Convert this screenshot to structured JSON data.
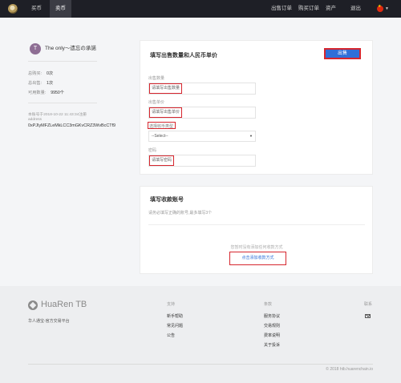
{
  "nav": {
    "buy": "买币",
    "sell": "卖币",
    "sell_orders": "出售订单",
    "buy_orders": "购买订单",
    "assets": "资产",
    "logout": "退出"
  },
  "user": {
    "avatar_letter": "T",
    "name": "The only～遗忘の承諾",
    "stats": [
      {
        "label": "总购买:",
        "value": "0次"
      },
      {
        "label": "总出售:",
        "value": "1次"
      },
      {
        "label": "可用数量:",
        "value": "9950个"
      }
    ],
    "register_note": "本账号于2018-10-22 11:43:34注册",
    "address_label": "address",
    "address": "0xPJIyMFZLeMkLCC3mGKvCRZ3WvBcCTf9"
  },
  "sell_form": {
    "title": "填写出售数量和人民币单价",
    "submit": "出售",
    "fields": [
      {
        "label": "出售数量",
        "placeholder": "请填写出售数量"
      },
      {
        "label": "出售单价",
        "placeholder": "请填写出售单价"
      },
      {
        "label": "选择收币类型",
        "placeholder": "--Select--"
      },
      {
        "label": "密码",
        "placeholder": "请填写密码"
      }
    ]
  },
  "payment": {
    "title": "填写收款账号",
    "hint": "请务必填写正确的账号,最多填写3个",
    "empty_note": "您暂时没有添加任何收款方式",
    "add_link": "点击添加收款方式"
  },
  "footer": {
    "brand": "HuaRen TB",
    "tagline": "华人通宝-官方交易平台",
    "support_heading": "支持",
    "support_links": [
      "新手帮助",
      "常见问题",
      "公告"
    ],
    "service_heading": "条款",
    "service_links": [
      "服务协议",
      "交易规则",
      "费率说明",
      "关于投诉"
    ],
    "contact_heading": "联系",
    "copyright": "© 2018 htb.huarenchain.io"
  },
  "colors": {
    "accent": "#2f6fd8",
    "highlight": "#d6262e",
    "topbar": "#1e1f26"
  }
}
